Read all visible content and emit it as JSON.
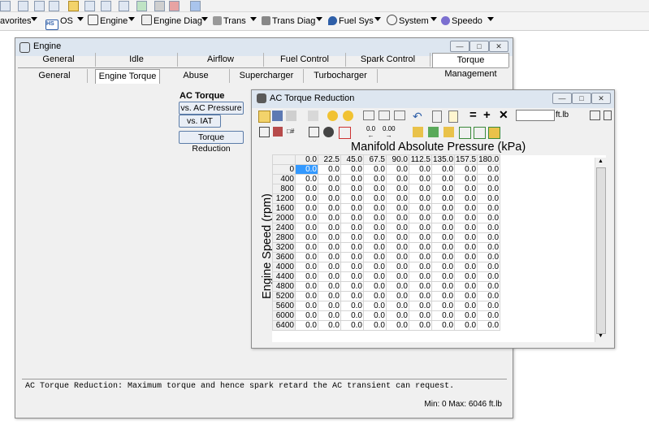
{
  "menubar": {
    "items": [
      {
        "label": "avorites",
        "icon": "favorites-icon"
      },
      {
        "label": "OS",
        "icon": "os-icon"
      },
      {
        "label": "Engine",
        "icon": "engine-icon"
      },
      {
        "label": "Engine Diag",
        "icon": "engine-diag-icon"
      },
      {
        "label": "Trans",
        "icon": "trans-icon"
      },
      {
        "label": "Trans Diag",
        "icon": "trans-diag-icon"
      },
      {
        "label": "Fuel Sys",
        "icon": "fuel-sys-icon"
      },
      {
        "label": "System",
        "icon": "system-icon"
      },
      {
        "label": "Speedo",
        "icon": "speedo-icon"
      }
    ],
    "os_badge": "HS"
  },
  "engine_window": {
    "title": "Engine",
    "tabs": [
      "General",
      "Idle",
      "Airflow",
      "Fuel Control",
      "Spark Control",
      "Torque Management"
    ],
    "selected_tab": "Torque Management",
    "subtabs": [
      "General",
      "Engine Torque",
      "Abuse",
      "Supercharger",
      "Turbocharger"
    ],
    "selected_subtab": "Engine Torque",
    "section_title": "AC Torque",
    "buttons": [
      "vs. AC Pressure",
      "vs. IAT",
      "Torque Reduction"
    ],
    "description": "AC Torque Reduction: Maximum torque and hence spark retard the AC transient can request.",
    "status": "Min: 0 Max: 6046 ft.lb"
  },
  "table_window": {
    "title": "AC Torque Reduction",
    "units": "ft.lb",
    "input_value": "",
    "toolbar2_labels": [
      "0.0",
      "0.00"
    ],
    "x_axis_label": "Manifold Absolute Pressure (kPa)",
    "y_axis_label": "Engine Speed (rpm)",
    "columns": [
      "0.0",
      "22.5",
      "45.0",
      "67.5",
      "90.0",
      "112.5",
      "135.0",
      "157.5",
      "180.0"
    ],
    "rows": [
      "0",
      "400",
      "800",
      "1200",
      "1600",
      "2000",
      "2400",
      "2800",
      "3200",
      "3600",
      "4000",
      "4400",
      "4800",
      "5200",
      "5600",
      "6000",
      "6400"
    ],
    "cell_value": "0.0",
    "selected_cell": {
      "row": 0,
      "col": 0
    }
  },
  "colors": {
    "selected_cell": "#3399ff",
    "titlebar": "#dde6f0"
  }
}
